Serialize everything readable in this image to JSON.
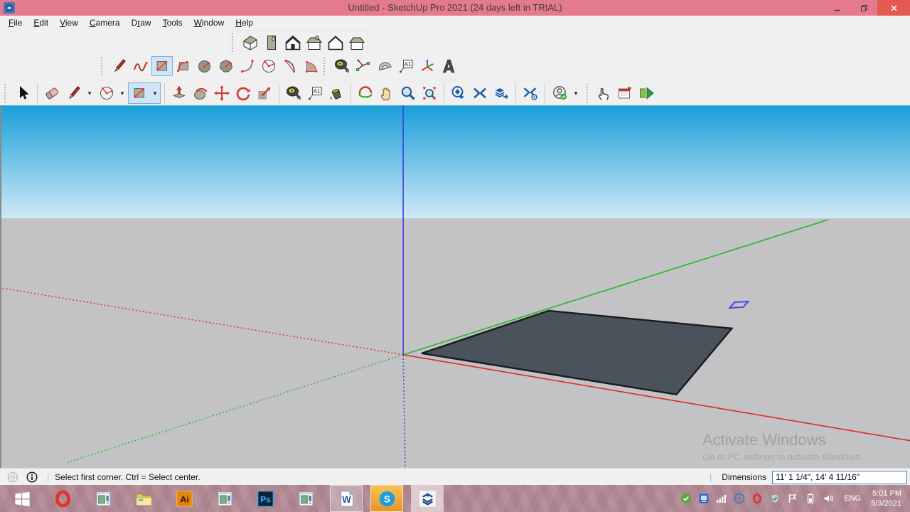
{
  "window": {
    "title": "Untitled - SketchUp Pro 2021 (24 days left in TRIAL)",
    "logo_icon": "sketchup-logo-icon",
    "controls": [
      {
        "icon": "minimize"
      },
      {
        "icon": "restore"
      },
      {
        "icon": "close"
      }
    ]
  },
  "menu": {
    "items": [
      {
        "pre": "",
        "m": "F",
        "post": "ile"
      },
      {
        "pre": "",
        "m": "E",
        "post": "dit"
      },
      {
        "pre": "",
        "m": "V",
        "post": "iew"
      },
      {
        "pre": "",
        "m": "C",
        "post": "amera"
      },
      {
        "pre": "D",
        "m": "r",
        "post": "aw"
      },
      {
        "pre": "",
        "m": "T",
        "post": "ools"
      },
      {
        "pre": "",
        "m": "W",
        "post": "indow"
      },
      {
        "pre": "",
        "m": "H",
        "post": "elp"
      }
    ]
  },
  "toolbars": {
    "views": {
      "items": [
        {
          "icon": "view-iso"
        },
        {
          "icon": "view-top"
        },
        {
          "icon": "view-front"
        },
        {
          "icon": "view-right"
        },
        {
          "icon": "view-back"
        },
        {
          "icon": "view-left"
        }
      ]
    },
    "draw": {
      "items": [
        {
          "icon": "line"
        },
        {
          "icon": "freehand"
        },
        {
          "icon": "rectangle",
          "selected": true
        },
        {
          "icon": "rotated-rectangle"
        },
        {
          "icon": "circle"
        },
        {
          "icon": "polygon"
        },
        {
          "icon": "arc"
        },
        {
          "icon": "pie"
        },
        {
          "icon": "two-point-arc"
        },
        {
          "icon": "three-point-arc"
        }
      ]
    },
    "construction": {
      "items": [
        {
          "icon": "tape-measure"
        },
        {
          "icon": "dimension"
        },
        {
          "icon": "protractor"
        },
        {
          "icon": "text"
        },
        {
          "icon": "axes"
        },
        {
          "icon": "three-d-text"
        }
      ]
    },
    "main": {
      "items": [
        {
          "icon": "select"
        },
        {
          "type": "sep"
        },
        {
          "icon": "eraser"
        },
        {
          "icon": "line",
          "caret": true
        },
        {
          "icon": "pie",
          "caret": true
        },
        {
          "icon": "rectangle",
          "caret": true,
          "selected": true
        },
        {
          "type": "sep"
        },
        {
          "icon": "push-pull"
        },
        {
          "icon": "follow-me"
        },
        {
          "icon": "move"
        },
        {
          "icon": "rotate"
        },
        {
          "icon": "scale"
        },
        {
          "type": "sep"
        },
        {
          "icon": "tape-measure"
        },
        {
          "icon": "text"
        },
        {
          "icon": "paint-bucket"
        },
        {
          "type": "sep"
        },
        {
          "icon": "orbit"
        },
        {
          "icon": "pan"
        },
        {
          "icon": "zoom"
        },
        {
          "icon": "zoom-extents"
        },
        {
          "type": "sep"
        },
        {
          "icon": "get-models"
        },
        {
          "icon": "share-model"
        },
        {
          "icon": "share-component"
        },
        {
          "type": "sep"
        },
        {
          "icon": "extension-warehouse"
        },
        {
          "type": "sep"
        },
        {
          "icon": "sign-in",
          "caret": true
        },
        {
          "type": "dotsep"
        },
        {
          "icon": "hand-pointer"
        },
        {
          "icon": "instructor"
        },
        {
          "icon": "send-to-layout"
        }
      ]
    }
  },
  "viewport": {
    "colors": {
      "sky_top": "#199fd9",
      "sky_bottom": "#cfe9f6",
      "ground": "#c3c3c5",
      "axis_red": "#dd2a2a",
      "axis_green": "#28b628",
      "axis_blue": "#4040e0",
      "face_fill": "#4a525b",
      "face_edge": "#1a1a1a",
      "cursor": "#4646ee"
    },
    "watermark": {
      "line1": "Activate Windows",
      "line2": "Go to PC settings to activate Windows."
    }
  },
  "statusbar": {
    "icons": [
      {
        "icon": "geolocation"
      },
      {
        "icon": "info"
      }
    ],
    "pipe": "|",
    "message": "Select first corner. Ctrl = Select center.",
    "dimensions_label": "Dimensions",
    "dimensions_value": "11' 1 1/4\", 14' 4 11/16\""
  },
  "taskbar": {
    "apps": [
      {
        "icon": "start"
      },
      {
        "icon": "opera"
      },
      {
        "icon": "generic-app"
      },
      {
        "icon": "file-explorer"
      },
      {
        "icon": "illustrator"
      },
      {
        "icon": "generic-app"
      },
      {
        "icon": "photoshop"
      },
      {
        "icon": "generic-app"
      },
      {
        "icon": "word",
        "active": true
      },
      {
        "icon": "skype",
        "attention": true
      },
      {
        "icon": "sketchup",
        "focused": true
      }
    ],
    "tray": [
      {
        "icon": "green-check"
      },
      {
        "icon": "monitor-app"
      },
      {
        "icon": "signal"
      },
      {
        "icon": "dell"
      },
      {
        "icon": "opera-mini"
      },
      {
        "icon": "shield-check"
      },
      {
        "icon": "flag"
      },
      {
        "icon": "battery"
      },
      {
        "icon": "speaker"
      }
    ],
    "language": "ENG",
    "time": "5:01 PM",
    "date": "5/3/2021"
  }
}
